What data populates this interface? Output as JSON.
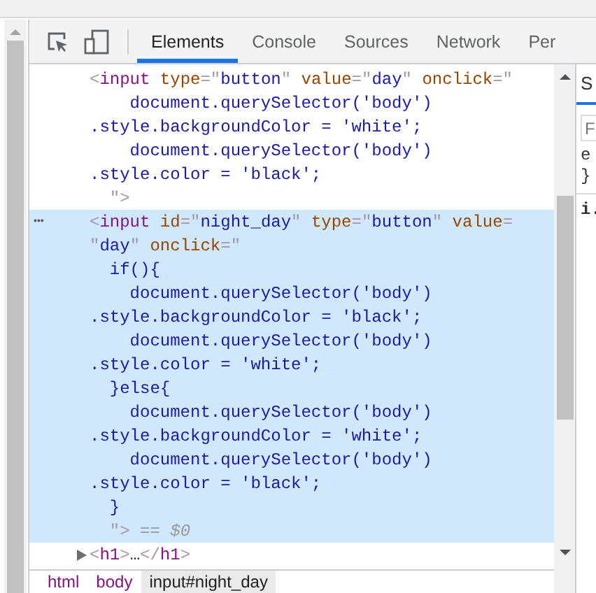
{
  "toolbar": {
    "tabs": [
      {
        "label": "Elements",
        "selected": true
      },
      {
        "label": "Console",
        "selected": false
      },
      {
        "label": "Sources",
        "selected": false
      },
      {
        "label": "Network",
        "selected": false
      },
      {
        "label": "Per",
        "selected": false
      }
    ]
  },
  "dom_tree": {
    "nodes": [
      {
        "selected": false,
        "lines": [
          [
            {
              "kind": "punct",
              "text": "<"
            },
            {
              "kind": "tag",
              "text": "input"
            },
            {
              "kind": "attr",
              "text": " type"
            },
            {
              "kind": "punct",
              "text": "=\""
            },
            {
              "kind": "value",
              "text": "button"
            },
            {
              "kind": "punct",
              "text": "\""
            },
            {
              "kind": "attr",
              "text": " value"
            },
            {
              "kind": "punct",
              "text": "=\""
            },
            {
              "kind": "value",
              "text": "day"
            },
            {
              "kind": "punct",
              "text": "\""
            },
            {
              "kind": "attr",
              "text": " onclick"
            },
            {
              "kind": "punct",
              "text": "=\""
            }
          ],
          [
            {
              "kind": "value",
              "text": "    document.querySelector('body')"
            }
          ],
          [
            {
              "kind": "value",
              "text": ".style.backgroundColor = 'white';"
            }
          ],
          [
            {
              "kind": "value",
              "text": "    document.querySelector('body')"
            }
          ],
          [
            {
              "kind": "value",
              "text": ".style.color = 'black';"
            }
          ],
          [
            {
              "kind": "punct",
              "text": "  \">"
            }
          ]
        ]
      },
      {
        "selected": true,
        "gutter": "•••",
        "lines": [
          [
            {
              "kind": "punct",
              "text": "<"
            },
            {
              "kind": "tag",
              "text": "input"
            },
            {
              "kind": "attr",
              "text": " id"
            },
            {
              "kind": "punct",
              "text": "=\""
            },
            {
              "kind": "value",
              "text": "night_day"
            },
            {
              "kind": "punct",
              "text": "\""
            },
            {
              "kind": "attr",
              "text": " type"
            },
            {
              "kind": "punct",
              "text": "=\""
            },
            {
              "kind": "value",
              "text": "button"
            },
            {
              "kind": "punct",
              "text": "\""
            },
            {
              "kind": "attr",
              "text": " value"
            },
            {
              "kind": "punct",
              "text": "="
            }
          ],
          [
            {
              "kind": "punct",
              "text": "\""
            },
            {
              "kind": "value",
              "text": "day"
            },
            {
              "kind": "punct",
              "text": "\""
            },
            {
              "kind": "attr",
              "text": " onclick"
            },
            {
              "kind": "punct",
              "text": "=\""
            }
          ],
          [
            {
              "kind": "value",
              "text": "  if(){"
            }
          ],
          [
            {
              "kind": "value",
              "text": "    document.querySelector('body')"
            }
          ],
          [
            {
              "kind": "value",
              "text": ".style.backgroundColor = 'black';"
            }
          ],
          [
            {
              "kind": "value",
              "text": "    document.querySelector('body')"
            }
          ],
          [
            {
              "kind": "value",
              "text": ".style.color = 'white';"
            }
          ],
          [
            {
              "kind": "value",
              "text": "  }else{"
            }
          ],
          [
            {
              "kind": "value",
              "text": "    document.querySelector('body')"
            }
          ],
          [
            {
              "kind": "value",
              "text": ".style.backgroundColor = 'white';"
            }
          ],
          [
            {
              "kind": "value",
              "text": "    document.querySelector('body')"
            }
          ],
          [
            {
              "kind": "value",
              "text": ".style.color = 'black';"
            }
          ],
          [
            {
              "kind": "value",
              "text": "  }"
            }
          ],
          [
            {
              "kind": "punct",
              "text": "  \">"
            },
            {
              "kind": "dim",
              "text": " == $0"
            }
          ]
        ]
      },
      {
        "selected": false,
        "expanded": false,
        "lines": [
          [
            {
              "kind": "punct",
              "text": "<"
            },
            {
              "kind": "tag",
              "text": "h1"
            },
            {
              "kind": "punct",
              "text": ">"
            },
            {
              "kind": "text",
              "text": "…"
            },
            {
              "kind": "punct",
              "text": "</"
            },
            {
              "kind": "tag",
              "text": "h1"
            },
            {
              "kind": "punct",
              "text": ">"
            }
          ]
        ]
      }
    ]
  },
  "breadcrumbs": [
    {
      "label": "html",
      "selected": false
    },
    {
      "label": "body",
      "selected": false
    },
    {
      "label": "input#night_day",
      "selected": true
    }
  ],
  "sidebar": {
    "tab": "S",
    "filter_placeholder": "F",
    "rule_lines": [
      "e",
      "}"
    ],
    "section": "i."
  }
}
